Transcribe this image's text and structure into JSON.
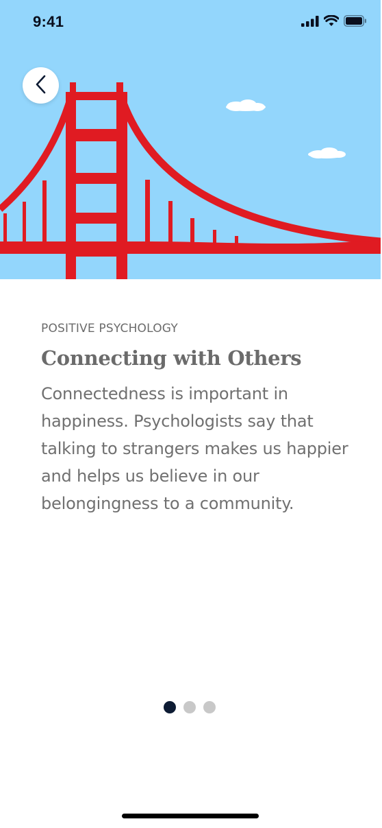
{
  "status_bar": {
    "time": "9:41",
    "icons": [
      "signal-icon",
      "wifi-icon",
      "battery-icon"
    ]
  },
  "hero": {
    "description": "bridge-illustration",
    "colors": {
      "sky": "#93d6fc",
      "bridge": "#e01b22",
      "cloud": "#ffffff"
    }
  },
  "back_button": {
    "icon": "chevron-left-icon"
  },
  "article": {
    "category": "POSITIVE PSYCHOLOGY",
    "title": "Connecting with Others",
    "description": "Connectedness is important in happiness. Psychologists say that talking to strangers makes us happier and helps us believe in our belongingness to a community."
  },
  "pager": {
    "total": 3,
    "active_index": 0,
    "colors": {
      "active": "#0d1b33",
      "inactive": "#c8c8c8"
    }
  }
}
